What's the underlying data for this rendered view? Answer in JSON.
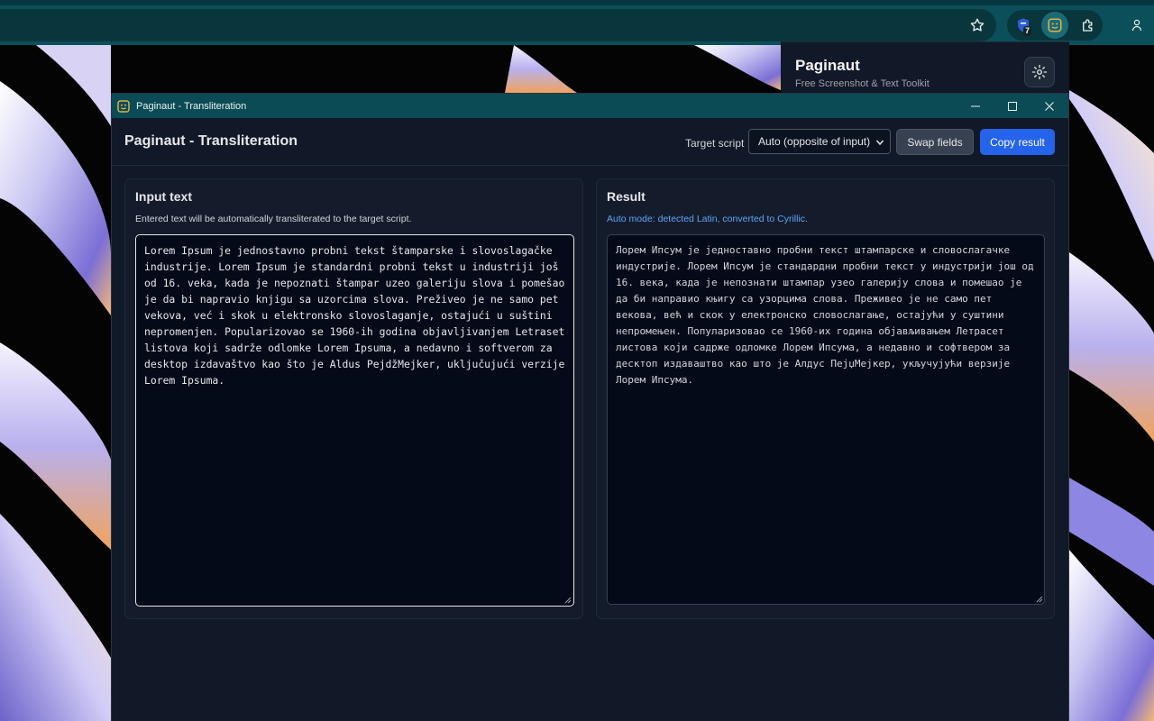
{
  "browser": {
    "extension_badge_count": "7",
    "icons": [
      "star-icon",
      "shield-extension-icon",
      "paginaut-extension-icon",
      "puzzle-extensions-icon",
      "profile-icon"
    ]
  },
  "popup": {
    "title": "Paginaut",
    "subtitle": "Free Screenshot & Text Toolkit"
  },
  "window": {
    "title": "Paginaut - Transliteration"
  },
  "header": {
    "title": "Paginaut - Transliteration",
    "target_label": "Target script",
    "target_value": "Auto (opposite of input)",
    "swap_label": "Swap fields",
    "copy_label": "Copy result"
  },
  "input_panel": {
    "heading": "Input text",
    "hint": "Entered text will be automatically transliterated to the target script.",
    "text": "Lorem Ipsum je jednostavno probni tekst štamparske i slovoslagačke industrije. Lorem Ipsum je standardni probni tekst u industriji još od 16. veka, kada je nepoznati štampar uzeo galeriju slova i pomešao je da bi napravio knjigu sa uzorcima slova. Preživeo je ne samo pet vekova, već i skok u elektronsko slovoslaganje, ostajući u suštini nepromenjen. Popularizovao se 1960-ih godina objavljivanjem Letraset listova koji sadrže odlomke Lorem Ipsuma, a nedavno i softverom za desktop izdavaštvo kao što je Aldus PejdžMejker, uključujući verzije Lorem Ipsuma."
  },
  "result_panel": {
    "heading": "Result",
    "hint": "Auto mode: detected Latin, converted to Cyrillic.",
    "text": "Лорем Ипсум је једноставно пробни текст штампарске и словослагачке индустрије. Лорем Ипсум је стандардни пробни текст у индустрији још од 16. века, када је непознати штампар узео галерију слова и помешао је да би направио књигу са узорцима слова. Преживео је не само пет векова, већ и скок у електронско словослагање, остајући у суштини непромењен. Популаризовао се 1960-их година објављивањем Летрасет листова који садрже одломке Лорем Ипсума, а недавно и софтвером за десктоп издаваштво као што је Алдус ПејџМејкер, укључујући верзије Лорем Ипсума."
  },
  "colors": {
    "accent": "#2563eb",
    "titlebar": "#0a4b55",
    "app_background": "#111827",
    "hint_blue": "#60a5fa"
  }
}
